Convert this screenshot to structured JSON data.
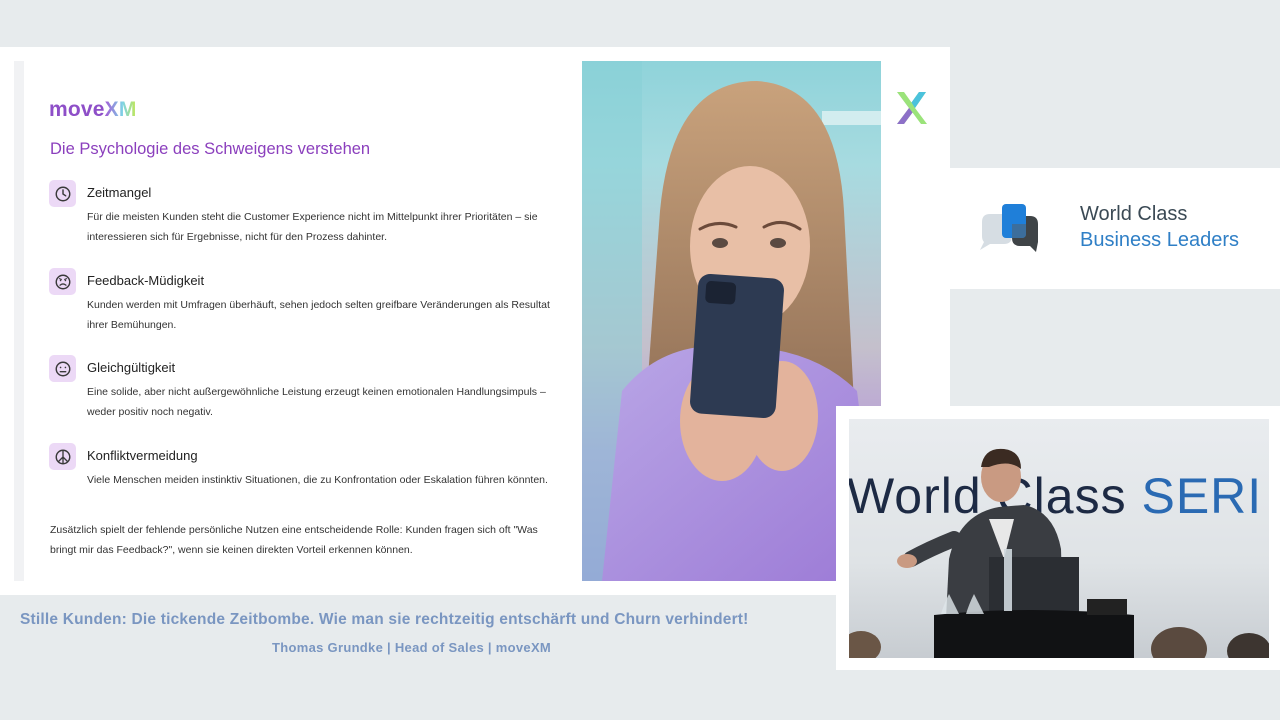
{
  "slide": {
    "logo": {
      "part1": "move",
      "part2": "XM"
    },
    "title": "Die Psychologie des Schweigens verstehen",
    "items": [
      {
        "icon": "clock-icon",
        "title": "Zeitmangel",
        "text": "Für die meisten Kunden steht die Customer Experience nicht im Mittelpunkt ihrer Prioritäten – sie interessieren sich für Ergebnisse, nicht für den Prozess dahinter."
      },
      {
        "icon": "frown-face-icon",
        "title": "Feedback-Müdigkeit",
        "text": "Kunden werden mit Umfragen überhäuft, sehen jedoch selten greifbare Veränderungen als Resultat ihrer Bemühungen."
      },
      {
        "icon": "neutral-face-icon",
        "title": "Gleichgültigkeit",
        "text": "Eine solide, aber nicht außergewöhnliche Leistung erzeugt keinen emotionalen Handlungsimpuls – weder positiv noch negativ."
      },
      {
        "icon": "peace-icon",
        "title": "Konfliktvermeidung",
        "text": "Viele Menschen meiden instinktiv Situationen, die zu Konfrontation oder Eskalation führen könnten."
      }
    ],
    "footnote": "Zusätzlich spielt der fehlende persönliche Nutzen eine entscheidende Rolle: Kunden fragen sich oft \"Was bringt mir das Feedback?\", wenn sie keinen direkten Vorteil erkennen können."
  },
  "brand": {
    "line1": "World Class",
    "line2": "Business Leaders"
  },
  "video": {
    "backdrop_text_part1": "World Class ",
    "backdrop_text_part2": "SERI"
  },
  "caption": {
    "title": "Stille Kunden: Die tickende Zeitbombe. Wie man sie rechtzeitig entschärft und Churn verhindert!",
    "speaker": "Thomas Grundke | Head of Sales | moveXM"
  },
  "colors": {
    "accent_purple": "#8b3fbd",
    "icon_bg": "#ecd9f6",
    "caption_blue": "#7a96c1",
    "brand_blue": "#2f7fc6"
  }
}
